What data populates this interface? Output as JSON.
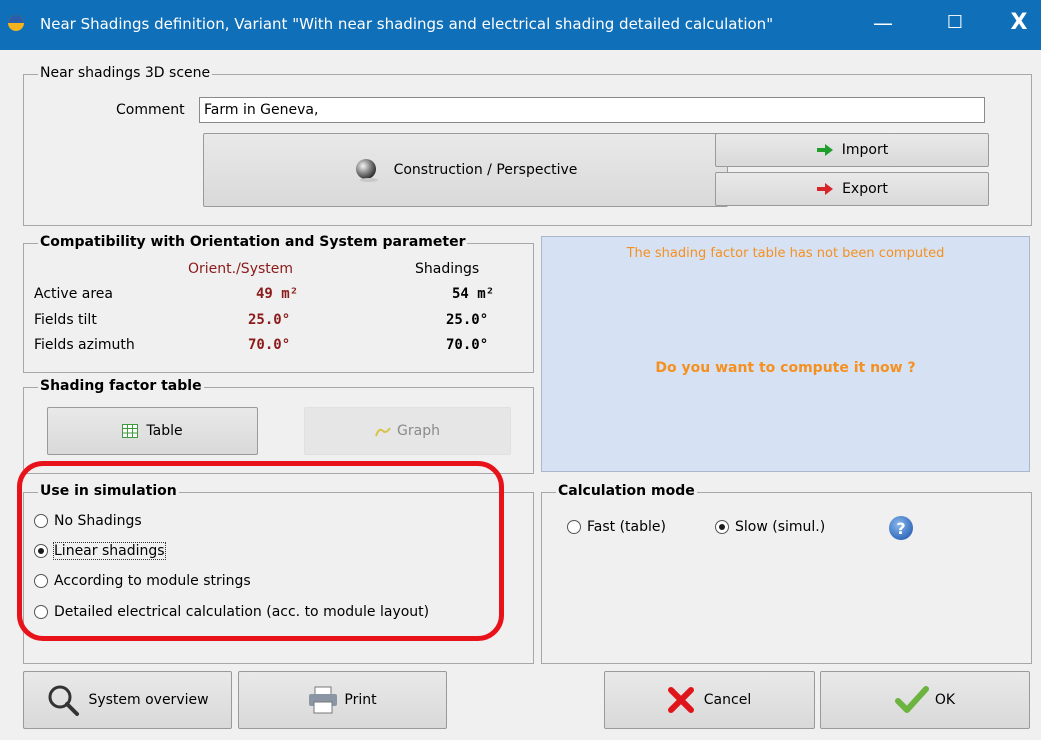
{
  "window": {
    "title": "Near Shadings definition, Variant \"With near shadings and electrical shading detailed calculation\"",
    "minimize": "—",
    "maximize": "☐",
    "close": "X"
  },
  "scene": {
    "legend": "Near shadings 3D scene",
    "comment_label": "Comment",
    "comment_value": "Farm in Geneva,",
    "construction_label": "Construction / Perspective",
    "import_label": "Import",
    "export_label": "Export"
  },
  "compat": {
    "legend": "Compatibility with Orientation and System parameter",
    "col_orient": "Orient./System",
    "col_shadings": "Shadings",
    "rows": [
      {
        "label": "Active area",
        "orient": "49 m²",
        "shadings": "54 m²"
      },
      {
        "label": "Fields tilt",
        "orient": "25.0°",
        "shadings": "25.0°"
      },
      {
        "label": "Fields azimuth",
        "orient": "70.0°",
        "shadings": "70.0°"
      }
    ],
    "orient_color": "#8b1a1a"
  },
  "info": {
    "not_computed": "The shading factor table has not been computed",
    "question": "Do you want to compute it now ?",
    "panel_color": "#d6e2f4",
    "text_color": "#f5901e"
  },
  "sft": {
    "legend": "Shading factor table",
    "table_label": "Table",
    "graph_label": "Graph"
  },
  "use": {
    "legend": "Use in simulation",
    "options": [
      {
        "label": "No Shadings",
        "checked": false
      },
      {
        "label": "Linear shadings",
        "checked": true
      },
      {
        "label": "According to module strings",
        "checked": false
      },
      {
        "label": "Detailed electrical calculation (acc. to module layout)",
        "checked": false
      }
    ],
    "highlight_color": "#e8131a"
  },
  "calc": {
    "legend": "Calculation mode",
    "fast_label": "Fast (table)",
    "slow_label": "Slow (simul.)",
    "selected": "slow",
    "help_icon": "question-icon"
  },
  "footer": {
    "overview_label": "System overview",
    "print_label": "Print",
    "cancel_label": "Cancel",
    "ok_label": "OK"
  }
}
